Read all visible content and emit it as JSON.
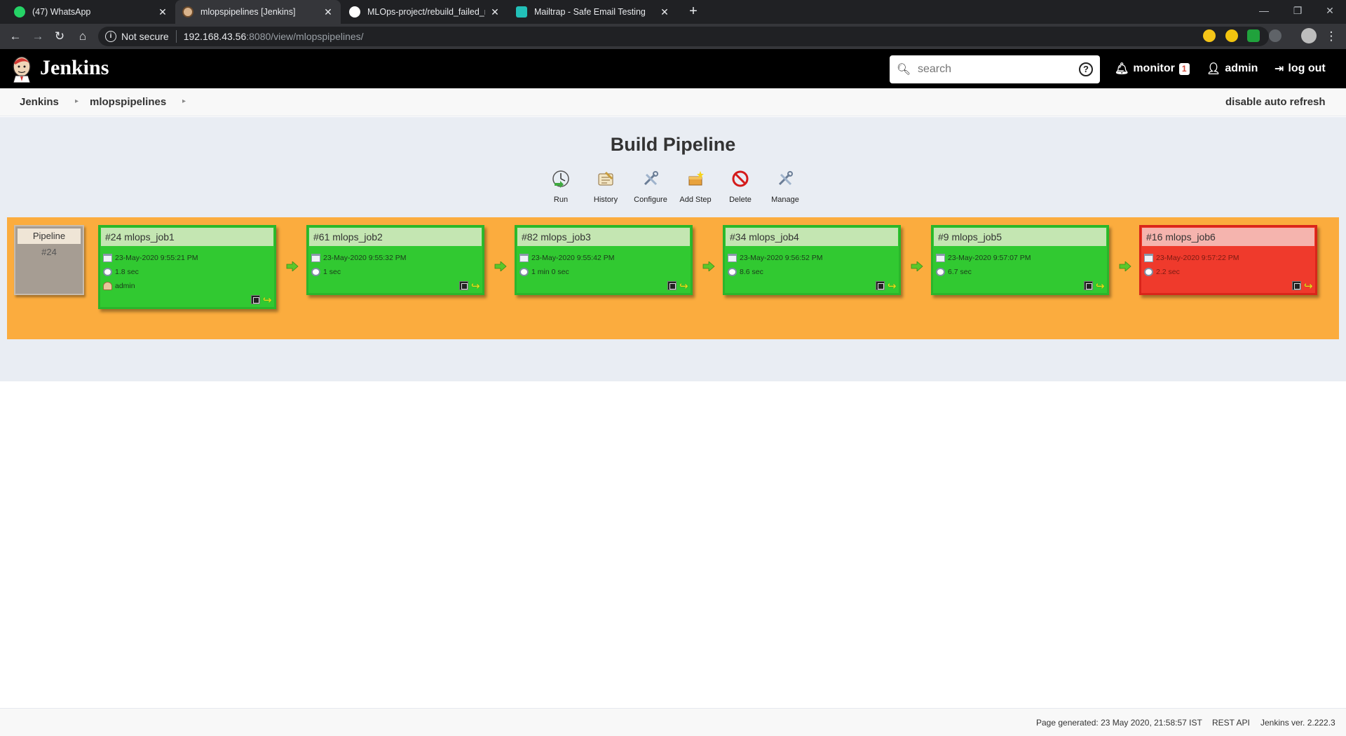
{
  "browser": {
    "tabs": [
      {
        "title": "(47) WhatsApp",
        "favicon": "whatsapp-icon",
        "active": false
      },
      {
        "title": "mlopspipelines [Jenkins]",
        "favicon": "jenkins-icon",
        "active": true
      },
      {
        "title": "MLOps-project/rebuild_failed_no",
        "favicon": "github-icon",
        "active": false
      },
      {
        "title": "Mailtrap - Safe Email Testing",
        "favicon": "mailtrap-icon",
        "active": false
      }
    ],
    "new_tab": "+",
    "security": "Not secure",
    "url_host": "192.168.43.56",
    "url_path": ":8080/view/mlopspipelines/"
  },
  "jenkins": {
    "title": "Jenkins",
    "search_placeholder": "search",
    "monitor_label": "monitor",
    "monitor_count": "1",
    "user_label": "admin",
    "logout_label": "log out"
  },
  "breadcrumb": {
    "items": [
      "Jenkins",
      "mlopspipelines"
    ],
    "auto_refresh": "disable auto refresh"
  },
  "pipeline": {
    "heading": "Build Pipeline",
    "actions": [
      "Run",
      "History",
      "Configure",
      "Add Step",
      "Delete",
      "Manage"
    ],
    "revision": {
      "title": "Pipeline",
      "number": "#24"
    },
    "builds": [
      {
        "name": "#24 mlops_job1",
        "date": "23-May-2020 9:55:21 PM",
        "duration": "1.8 sec",
        "user": "admin",
        "status": "success"
      },
      {
        "name": "#61 mlops_job2",
        "date": "23-May-2020 9:55:32 PM",
        "duration": "1 sec",
        "status": "success"
      },
      {
        "name": "#82 mlops_job3",
        "date": "23-May-2020 9:55:42 PM",
        "duration": "1 min 0 sec",
        "status": "success"
      },
      {
        "name": "#34 mlops_job4",
        "date": "23-May-2020 9:56:52 PM",
        "duration": "8.6 sec",
        "status": "success"
      },
      {
        "name": "#9 mlops_job5",
        "date": "23-May-2020 9:57:07 PM",
        "duration": "6.7 sec",
        "status": "success"
      },
      {
        "name": "#16 mlops_job6",
        "date": "23-May-2020 9:57:22 PM",
        "duration": "2.2 sec",
        "status": "failed"
      }
    ],
    "colors": {
      "success": "#31c931",
      "failed": "#ef3a2c",
      "band": "#fbac3e"
    }
  },
  "footer": {
    "generated": "Page generated: 23 May 2020, 21:58:57 IST",
    "rest_api": "REST API",
    "version": "Jenkins ver. 2.222.3"
  }
}
